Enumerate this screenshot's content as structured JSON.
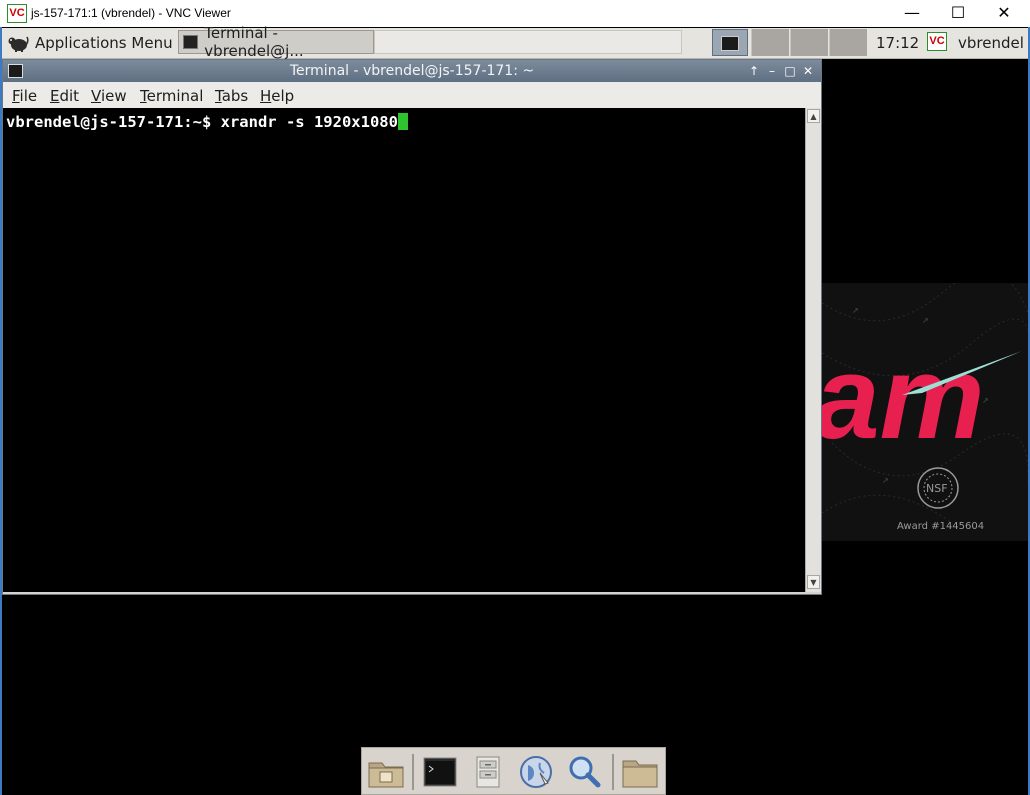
{
  "vnc_window": {
    "title": "js-157-171:1 (vbrendel) - VNC Viewer",
    "logo_text": "VC",
    "minimize_glyph": "—",
    "maximize_glyph": "☐",
    "close_glyph": "✕"
  },
  "top_panel": {
    "applications_menu_label": "Applications Menu",
    "taskbar_terminal_label": "Terminal - vbrendel@j...",
    "clock": "17:12",
    "user": "vbrendel",
    "workspaces": [
      1,
      2,
      3,
      4
    ]
  },
  "terminal": {
    "title": "Terminal - vbrendel@js-157-171: ~",
    "controls": {
      "above": "↑",
      "minimize": "–",
      "maximize": "□",
      "close": "✕"
    },
    "menu": {
      "file": {
        "accel": "F",
        "rest": "ile"
      },
      "edit": {
        "accel": "E",
        "rest": "dit"
      },
      "view": {
        "accel": "V",
        "rest": "iew"
      },
      "terminal": {
        "accel": "T",
        "rest": "erminal"
      },
      "tabs": {
        "accel": "T",
        "rest": "abs"
      },
      "help": {
        "accel": "H",
        "rest": "elp"
      }
    },
    "prompt": "vbrendel@js-157-171:~$ xrandr -s 1920x1080",
    "scroll_up": "▲",
    "scroll_down": "▼"
  },
  "wallpaper": {
    "logo_fragment": "am",
    "award": "Award #1445604",
    "seal_text": "NSF"
  },
  "dock": {
    "items": [
      "home-folder",
      "terminal",
      "file-manager",
      "web-browser",
      "search",
      "folder"
    ]
  },
  "colors": {
    "accent_blue": "#3c7ac4",
    "cursor_green": "#2ec42e",
    "logo_pink": "#e8204f",
    "logo_swoosh": "#9fded6"
  }
}
